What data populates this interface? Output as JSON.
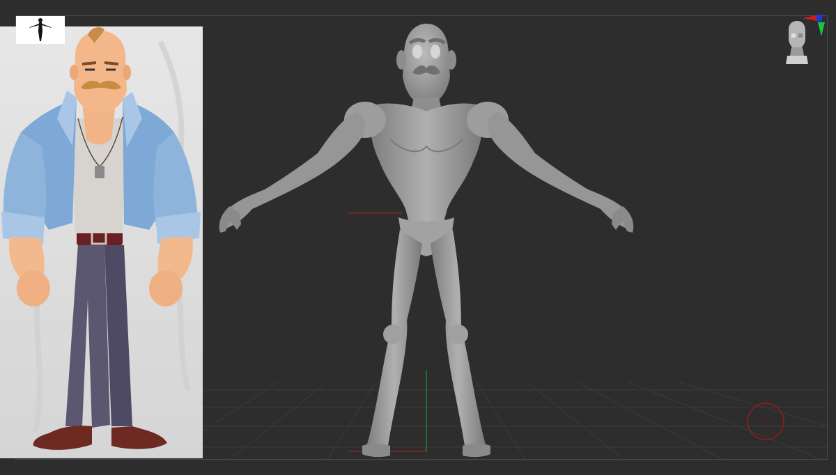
{
  "app": {
    "view": "3d-sculpt-viewport",
    "colors": {
      "background": "#2d2d2d",
      "frame": "#4a4a4a",
      "model": "#9a9a9a",
      "x_axis": "#d41c1c",
      "y_axis": "#1ec43c",
      "z_axis": "#1a3cd6"
    }
  },
  "reference": {
    "pose_thumbnail_icon": "t-pose-figure-icon",
    "image": "character-concept-art"
  },
  "viewport": {
    "model": "sculpted-male-body",
    "navigation_icon": "head-navigation-icon",
    "axis_gizmo_icon": "axis-gizmo-icon",
    "rotate_icon": "rotation-circle-icon"
  }
}
